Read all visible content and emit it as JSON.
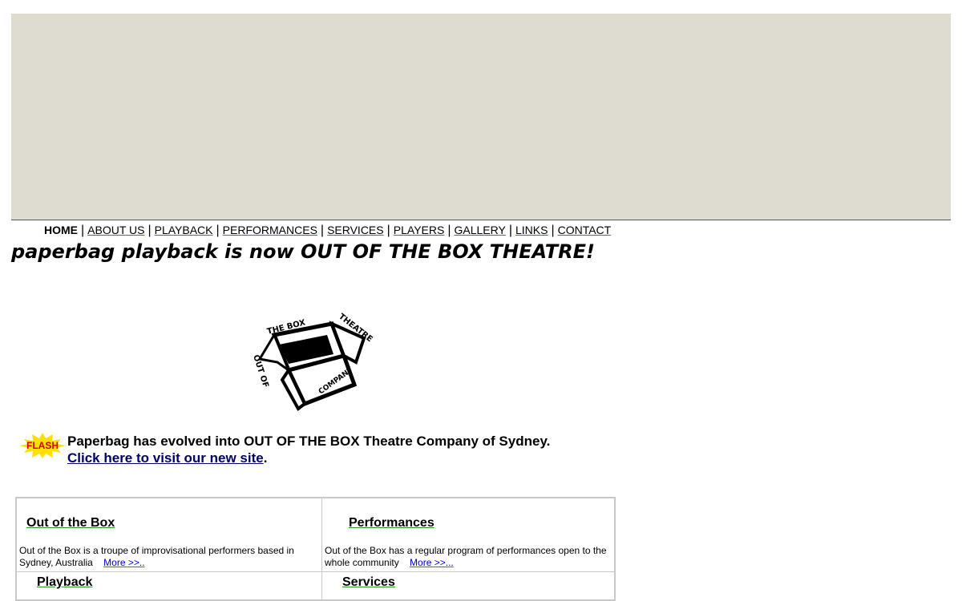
{
  "nav": {
    "items": [
      {
        "label": "HOME",
        "current": true
      },
      {
        "label": "ABOUT US"
      },
      {
        "label": "PLAYBACK"
      },
      {
        "label": "PERFORMANCES"
      },
      {
        "label": "SERVICES"
      },
      {
        "label": "PLAYERS"
      },
      {
        "label": "GALLERY"
      },
      {
        "label": "LINKS"
      },
      {
        "label": "CONTACT"
      }
    ],
    "separator": "|"
  },
  "headline": "paperbag playback is now OUT OF THE BOX THEATRE!",
  "logo": {
    "text_top": "THE BOX",
    "text_right": "THEATRE",
    "text_left": "OUT OF",
    "text_bottom": "COMPANY"
  },
  "flash": {
    "badge": "FLASH",
    "message": "Paperbag has evolved into OUT OF THE BOX Theatre Company of Sydney.",
    "link": "Click here to visit our new site",
    "suffix": "."
  },
  "sections": {
    "out_of_box": {
      "title": "Out of the Box",
      "text": "Out of the Box is a troupe of improvisational performers based in Sydney, Australia",
      "more": "More >>.."
    },
    "performances": {
      "title": "Performances",
      "text": "Out of the Box has a regular program of performances open to the whole community",
      "more": "More >>..."
    },
    "playback": {
      "title": "Playback"
    },
    "services": {
      "title": "Services"
    }
  },
  "colors": {
    "banner": "#dedbd0",
    "link_underline": "#2e8b2e",
    "new_site_link": "#000066",
    "more_link": "#0000cc",
    "flash_star": "#ffe000",
    "flash_text": "#cc0000"
  }
}
